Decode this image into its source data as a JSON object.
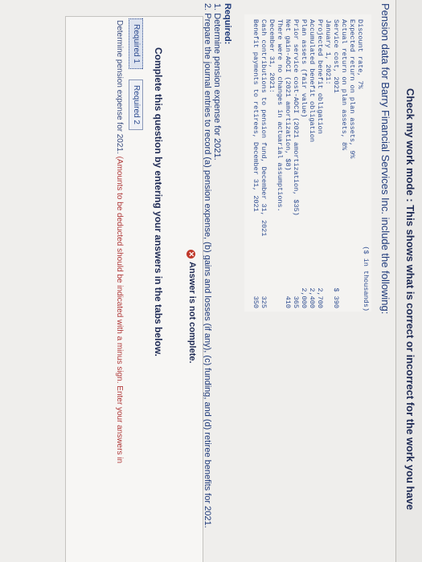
{
  "banner": {
    "text": "Check my work mode : This shows what is correct or incorrect for the work you have"
  },
  "problem": {
    "intro": "Pension data for Barry Financial Services Inc. include the following:",
    "units_header": "($ in thousands)",
    "rows": [
      {
        "label": "Discount rate, 7%",
        "value": ""
      },
      {
        "label": "Expected return on plan assets, 9%",
        "value": ""
      },
      {
        "label": "Actual return on plan assets, 8%",
        "value": ""
      },
      {
        "label": "Service cost, 2021",
        "value": "$ 390"
      },
      {
        "label": "January 1, 2021:",
        "value": ""
      },
      {
        "label": "Projected benefit obligation",
        "value": "2,700"
      },
      {
        "label": "Accumulated benefit obligation",
        "value": "2,400"
      },
      {
        "label": "Plan assets (fair value)",
        "value": "2,000"
      },
      {
        "label": "Prior service cost-AOCI (2021 amortization, $35)",
        "value": "365"
      },
      {
        "label": "Net gain-AOCI (2021 amortization, $8)",
        "value": "410"
      },
      {
        "label": "There were no changes in actuarial assumptions.",
        "value": ""
      },
      {
        "label": "December 31, 2021:",
        "value": ""
      },
      {
        "label": "Cash contributions to pension fund, December 31, 2021",
        "value": "325"
      },
      {
        "label": "Benefit payments to retirees, December 31, 2021",
        "value": "350"
      }
    ]
  },
  "required": {
    "title": "Required:",
    "items": [
      "1. Determine pension expense for 2021.",
      "2. Prepare the journal entries to record (a) pension expense, (b) gains and losses (if any), (c) funding, and (d) retiree benefits for 2021."
    ]
  },
  "answer_panel": {
    "status": "Answer is not complete.",
    "instruction": "Complete this question by entering your answers in the tabs below.",
    "tabs": [
      "Required 1",
      "Required 2"
    ],
    "determine_text": "Determine pension expense for 2021.",
    "determine_note": "(Amounts to be deducted should be indicated with a minus sign. Enter your answers in"
  }
}
